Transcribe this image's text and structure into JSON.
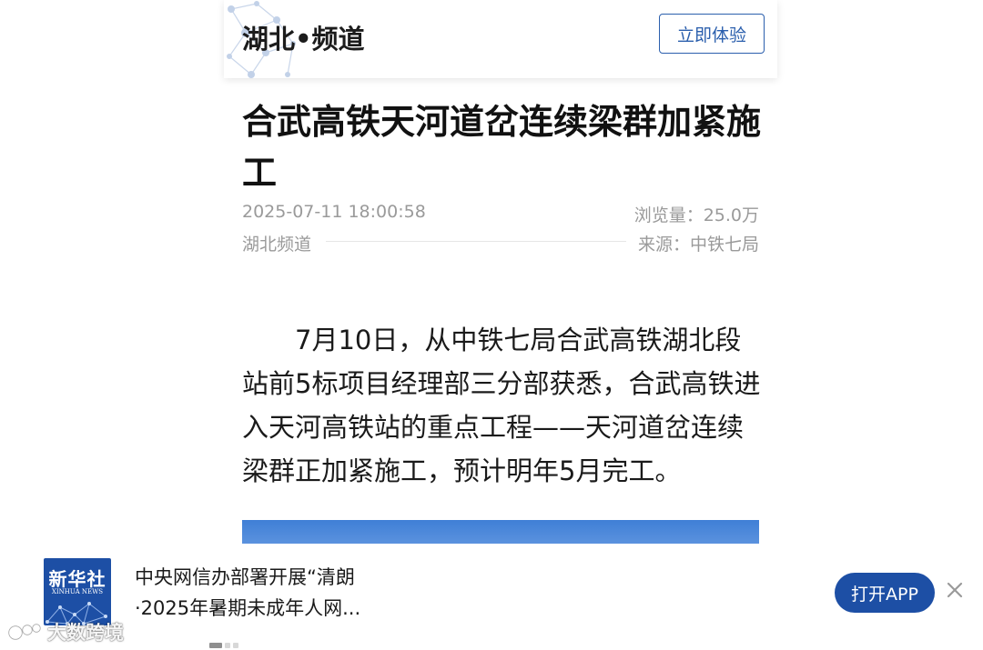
{
  "header": {
    "channel_title": "湖北•频道",
    "try_button_label": "立即体验"
  },
  "article": {
    "title": "合武高铁天河道岔连续梁群加紧施工",
    "date": "2025-07-11 18:00:58",
    "views": "浏览量：25.0万",
    "channel": "湖北频道",
    "source": "来源：中铁七局",
    "body": "7月10日，从中铁七局合武高铁湖北段站前5标项目经理部三分部获悉，合武高铁进入天河高铁站的重点工程——天河道岔连续梁群正加紧施工，预计明年5月完工。"
  },
  "app_banner": {
    "logo_cn": "新华社",
    "logo_en": "XINHUA NEWS",
    "headline": "中央网信办部署开展“清朗·2025年暑期未成年人网...",
    "open_app_label": "打开APP",
    "close_icon": "close-icon"
  },
  "watermark": {
    "text": "大数跨境"
  },
  "colors": {
    "brand_blue": "#1d4fa5",
    "button_outline": "#2b5fad",
    "meta_gray": "#9a9a9a",
    "image_blue": "#3f7fd6"
  }
}
